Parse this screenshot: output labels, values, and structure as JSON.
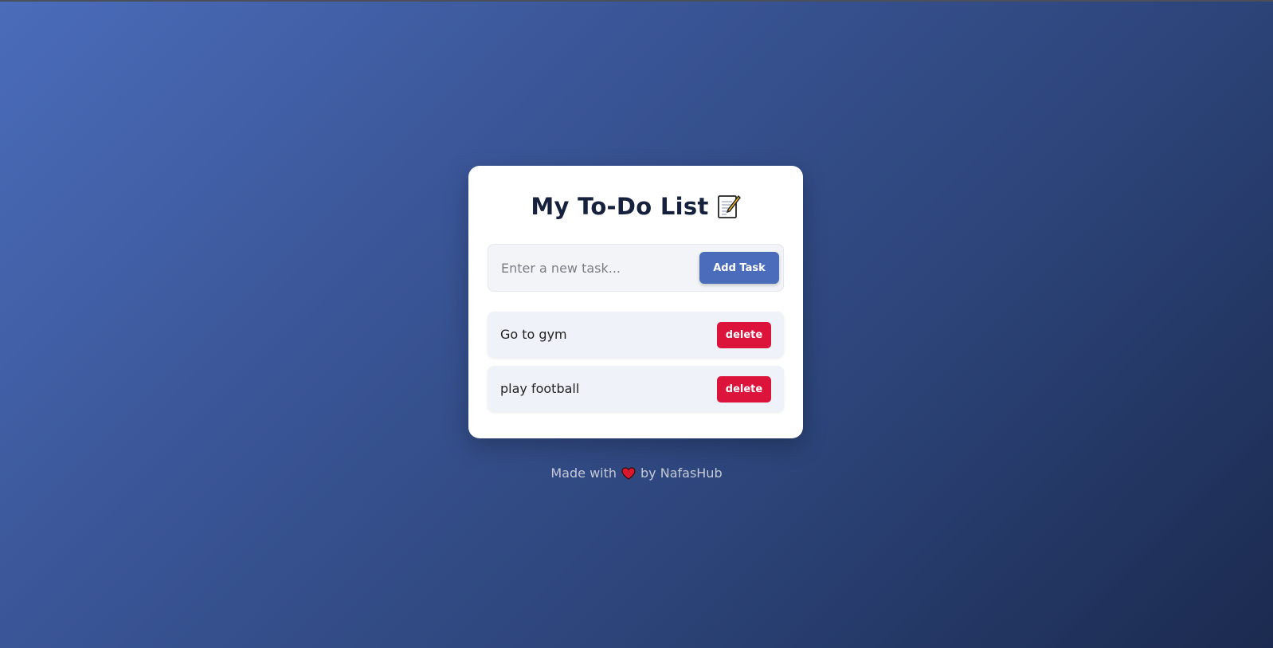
{
  "app": {
    "title": "My To-Do List"
  },
  "input": {
    "placeholder": "Enter a new task...",
    "value": "",
    "add_label": "Add Task"
  },
  "tasks": [
    {
      "text": "Go to gym",
      "delete_label": "delete"
    },
    {
      "text": "play football",
      "delete_label": "delete"
    }
  ],
  "footer": {
    "prefix": "Made with",
    "suffix": "by NafasHub",
    "icon": "heart-icon"
  },
  "colors": {
    "accent": "#4a6cba",
    "danger": "#dc143c",
    "title": "#16213e"
  },
  "icons": {
    "title_icon": "memo-icon"
  }
}
